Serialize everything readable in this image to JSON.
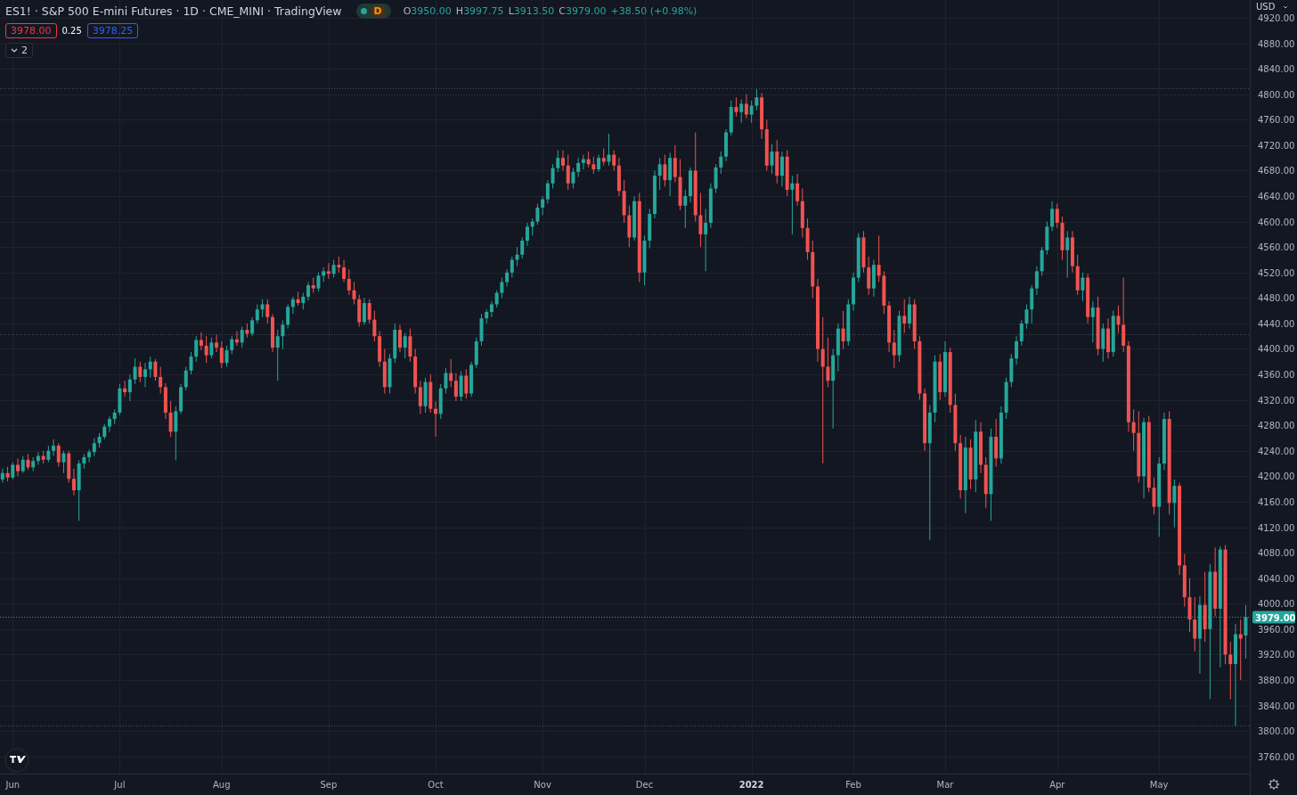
{
  "legend": {
    "title": "ES1! · S&P 500 E-mini Futures · 1D · CME_MINI · TradingView",
    "status_badge": {
      "label": "D"
    },
    "ohlc": [
      {
        "label": "O",
        "value": "3950.00"
      },
      {
        "label": "H",
        "value": "3997.75"
      },
      {
        "label": "L",
        "value": "3913.50"
      },
      {
        "label": "C",
        "value": "3979.00"
      }
    ],
    "change": "+38.50 (+0.98%)"
  },
  "quote": {
    "bid": "3978.00",
    "spread": "0.25",
    "ask": "3978.25"
  },
  "indicators_toggle": {
    "count": "2",
    "expanded": false
  },
  "price_axis": {
    "currency": "USD",
    "last_price": "3979.00"
  },
  "time_axis": {
    "labels": [
      {
        "kind": "month"
      },
      {
        "kind": "month"
      },
      {
        "kind": "month"
      },
      {
        "kind": "month"
      },
      {
        "kind": "month"
      },
      {
        "kind": "month"
      },
      {
        "kind": "month"
      },
      {
        "kind": "year"
      },
      {
        "kind": "month"
      },
      {
        "kind": "month"
      },
      {
        "kind": "month"
      },
      {
        "kind": "month"
      }
    ]
  },
  "chart_data": {
    "type": "candlestick",
    "grid": true,
    "ylim": [
      3733,
      4948
    ],
    "ref_lines": [
      {
        "axis": "y",
        "value": 4810,
        "color": "#4a4e59"
      },
      {
        "axis": "y",
        "value": 4423,
        "color": "#4a4e59"
      },
      {
        "axis": "y",
        "value": 3808,
        "color": "#4a4e59"
      },
      {
        "axis": "y",
        "value": 3979,
        "color": "#26a69a"
      }
    ],
    "categories": [
      null,
      null,
      "Jun",
      null,
      null,
      null,
      null,
      null,
      null,
      null,
      null,
      null,
      null,
      null,
      null,
      null,
      null,
      null,
      null,
      null,
      null,
      null,
      null,
      "Jul",
      null,
      null,
      null,
      null,
      null,
      null,
      null,
      null,
      null,
      null,
      null,
      null,
      null,
      null,
      null,
      null,
      null,
      null,
      null,
      "Aug",
      null,
      null,
      null,
      null,
      null,
      null,
      null,
      null,
      null,
      null,
      null,
      null,
      null,
      null,
      null,
      null,
      null,
      null,
      null,
      null,
      "Sep",
      null,
      null,
      null,
      null,
      null,
      null,
      null,
      null,
      null,
      null,
      null,
      null,
      null,
      null,
      null,
      null,
      null,
      null,
      null,
      null,
      "Oct",
      null,
      null,
      null,
      null,
      null,
      null,
      null,
      null,
      null,
      null,
      null,
      null,
      null,
      null,
      null,
      null,
      null,
      null,
      null,
      null,
      "Nov",
      null,
      null,
      null,
      null,
      null,
      null,
      null,
      null,
      null,
      null,
      null,
      null,
      null,
      null,
      null,
      null,
      null,
      null,
      null,
      "Dec",
      null,
      null,
      null,
      null,
      null,
      null,
      null,
      null,
      null,
      null,
      null,
      null,
      null,
      null,
      null,
      null,
      null,
      null,
      null,
      null,
      "2022",
      null,
      null,
      null,
      null,
      null,
      null,
      null,
      null,
      null,
      null,
      null,
      null,
      null,
      null,
      null,
      null,
      null,
      null,
      null,
      "Feb",
      null,
      null,
      null,
      null,
      null,
      null,
      null,
      null,
      null,
      null,
      null,
      null,
      null,
      null,
      null,
      null,
      null,
      "Mar",
      null,
      null,
      null,
      null,
      null,
      null,
      null,
      null,
      null,
      null,
      null,
      null,
      null,
      null,
      null,
      null,
      null,
      null,
      null,
      null,
      null,
      "Apr",
      null,
      null,
      null,
      null,
      null,
      null,
      null,
      null,
      null,
      null,
      null,
      null,
      null,
      null,
      null,
      null,
      null,
      null,
      null,
      "May",
      null,
      null,
      null,
      null,
      null,
      null,
      null,
      null,
      null,
      null,
      null,
      null,
      null,
      null,
      null,
      null,
      null
    ],
    "yticks": [
      {
        "value": 4920,
        "label": "4920.00"
      },
      {
        "value": 4880,
        "label": "4880.00"
      },
      {
        "value": 4840,
        "label": "4840.00"
      },
      {
        "value": 4800,
        "label": "4800.00"
      },
      {
        "value": 4760,
        "label": "4760.00"
      },
      {
        "value": 4720,
        "label": "4720.00"
      },
      {
        "value": 4680,
        "label": "4680.00"
      },
      {
        "value": 4640,
        "label": "4640.00"
      },
      {
        "value": 4600,
        "label": "4600.00"
      },
      {
        "value": 4560,
        "label": "4560.00"
      },
      {
        "value": 4520,
        "label": "4520.00"
      },
      {
        "value": 4480,
        "label": "4480.00"
      },
      {
        "value": 4440,
        "label": "4440.00"
      },
      {
        "value": 4400,
        "label": "4400.00"
      },
      {
        "value": 4360,
        "label": "4360.00"
      },
      {
        "value": 4320,
        "label": "4320.00"
      },
      {
        "value": 4280,
        "label": "4280.00"
      },
      {
        "value": 4240,
        "label": "4240.00"
      },
      {
        "value": 4200,
        "label": "4200.00"
      },
      {
        "value": 4160,
        "label": "4160.00"
      },
      {
        "value": 4120,
        "label": "4120.00"
      },
      {
        "value": 4080,
        "label": "4080.00"
      },
      {
        "value": 4040,
        "label": "4040.00"
      },
      {
        "value": 4000,
        "label": "4000.00"
      },
      {
        "value": 3960,
        "label": "3960.00"
      },
      {
        "value": 3920,
        "label": "3920.00"
      },
      {
        "value": 3880,
        "label": "3880.00"
      },
      {
        "value": 3840,
        "label": "3840.00"
      },
      {
        "value": 3800,
        "label": "3800.00"
      },
      {
        "value": 3760,
        "label": "3760.00"
      }
    ],
    "ohlc": [
      [
        4195,
        4212,
        4190,
        4205
      ],
      [
        4205,
        4215,
        4192,
        4198
      ],
      [
        4198,
        4222,
        4195,
        4218
      ],
      [
        4218,
        4228,
        4200,
        4208
      ],
      [
        4208,
        4232,
        4205,
        4226
      ],
      [
        4226,
        4235,
        4210,
        4214
      ],
      [
        4214,
        4230,
        4208,
        4224
      ],
      [
        4224,
        4238,
        4218,
        4232
      ],
      [
        4232,
        4240,
        4220,
        4226
      ],
      [
        4226,
        4248,
        4222,
        4240
      ],
      [
        4240,
        4258,
        4232,
        4248
      ],
      [
        4248,
        4252,
        4215,
        4222
      ],
      [
        4222,
        4240,
        4205,
        4236
      ],
      [
        4236,
        4240,
        4190,
        4196
      ],
      [
        4196,
        4212,
        4170,
        4178
      ],
      [
        4178,
        4225,
        4130,
        4220
      ],
      [
        4220,
        4235,
        4212,
        4230
      ],
      [
        4230,
        4242,
        4222,
        4238
      ],
      [
        4238,
        4260,
        4232,
        4252
      ],
      [
        4252,
        4268,
        4245,
        4262
      ],
      [
        4262,
        4282,
        4258,
        4278
      ],
      [
        4278,
        4294,
        4270,
        4290
      ],
      [
        4290,
        4305,
        4282,
        4300
      ],
      [
        4300,
        4345,
        4296,
        4338
      ],
      [
        4338,
        4350,
        4325,
        4332
      ],
      [
        4332,
        4360,
        4318,
        4352
      ],
      [
        4352,
        4385,
        4345,
        4372
      ],
      [
        4372,
        4380,
        4348,
        4356
      ],
      [
        4356,
        4378,
        4340,
        4368
      ],
      [
        4368,
        4388,
        4355,
        4380
      ],
      [
        4380,
        4384,
        4350,
        4356
      ],
      [
        4356,
        4372,
        4330,
        4340
      ],
      [
        4340,
        4346,
        4290,
        4300
      ],
      [
        4300,
        4318,
        4262,
        4270
      ],
      [
        4270,
        4310,
        4225,
        4302
      ],
      [
        4302,
        4345,
        4298,
        4340
      ],
      [
        4340,
        4372,
        4335,
        4366
      ],
      [
        4366,
        4395,
        4360,
        4388
      ],
      [
        4388,
        4420,
        4380,
        4414
      ],
      [
        4414,
        4426,
        4398,
        4405
      ],
      [
        4405,
        4420,
        4378,
        4390
      ],
      [
        4390,
        4418,
        4385,
        4410
      ],
      [
        4410,
        4422,
        4395,
        4402
      ],
      [
        4402,
        4412,
        4370,
        4378
      ],
      [
        4378,
        4405,
        4372,
        4398
      ],
      [
        4398,
        4420,
        4392,
        4415
      ],
      [
        4415,
        4428,
        4405,
        4410
      ],
      [
        4410,
        4435,
        4402,
        4430
      ],
      [
        4430,
        4440,
        4418,
        4424
      ],
      [
        4424,
        4450,
        4420,
        4445
      ],
      [
        4445,
        4470,
        4440,
        4462
      ],
      [
        4462,
        4478,
        4450,
        4470
      ],
      [
        4470,
        4478,
        4440,
        4450
      ],
      [
        4450,
        4455,
        4395,
        4402
      ],
      [
        4402,
        4430,
        4350,
        4420
      ],
      [
        4420,
        4445,
        4400,
        4438
      ],
      [
        4438,
        4470,
        4432,
        4466
      ],
      [
        4466,
        4482,
        4455,
        4478
      ],
      [
        4478,
        4490,
        4468,
        4472
      ],
      [
        4472,
        4488,
        4462,
        4482
      ],
      [
        4482,
        4505,
        4476,
        4500
      ],
      [
        4500,
        4512,
        4488,
        4495
      ],
      [
        4495,
        4520,
        4490,
        4515
      ],
      [
        4515,
        4528,
        4505,
        4522
      ],
      [
        4522,
        4535,
        4510,
        4518
      ],
      [
        4518,
        4540,
        4512,
        4532
      ],
      [
        4532,
        4545,
        4520,
        4528
      ],
      [
        4528,
        4540,
        4505,
        4510
      ],
      [
        4510,
        4525,
        4485,
        4492
      ],
      [
        4492,
        4505,
        4470,
        4478
      ],
      [
        4478,
        4485,
        4435,
        4442
      ],
      [
        4442,
        4480,
        4438,
        4472
      ],
      [
        4472,
        4478,
        4440,
        4446
      ],
      [
        4446,
        4460,
        4412,
        4420
      ],
      [
        4420,
        4428,
        4372,
        4380
      ],
      [
        4380,
        4400,
        4330,
        4340
      ],
      [
        4340,
        4392,
        4330,
        4385
      ],
      [
        4385,
        4440,
        4378,
        4430
      ],
      [
        4430,
        4438,
        4395,
        4402
      ],
      [
        4402,
        4425,
        4385,
        4420
      ],
      [
        4420,
        4432,
        4380,
        4388
      ],
      [
        4388,
        4400,
        4330,
        4340
      ],
      [
        4340,
        4350,
        4298,
        4310
      ],
      [
        4310,
        4355,
        4300,
        4348
      ],
      [
        4348,
        4360,
        4300,
        4306
      ],
      [
        4306,
        4318,
        4262,
        4298
      ],
      [
        4298,
        4345,
        4290,
        4338
      ],
      [
        4338,
        4370,
        4330,
        4362
      ],
      [
        4362,
        4384,
        4340,
        4350
      ],
      [
        4350,
        4362,
        4318,
        4325
      ],
      [
        4325,
        4365,
        4318,
        4358
      ],
      [
        4358,
        4368,
        4322,
        4330
      ],
      [
        4330,
        4380,
        4325,
        4375
      ],
      [
        4375,
        4418,
        4370,
        4412
      ],
      [
        4412,
        4455,
        4405,
        4448
      ],
      [
        4448,
        4462,
        4440,
        4458
      ],
      [
        4458,
        4475,
        4450,
        4470
      ],
      [
        4470,
        4492,
        4465,
        4488
      ],
      [
        4488,
        4512,
        4480,
        4505
      ],
      [
        4505,
        4525,
        4498,
        4520
      ],
      [
        4520,
        4545,
        4512,
        4540
      ],
      [
        4540,
        4560,
        4530,
        4548
      ],
      [
        4548,
        4575,
        4542,
        4570
      ],
      [
        4570,
        4598,
        4562,
        4592
      ],
      [
        4592,
        4605,
        4578,
        4600
      ],
      [
        4600,
        4628,
        4595,
        4622
      ],
      [
        4622,
        4640,
        4610,
        4635
      ],
      [
        4635,
        4665,
        4628,
        4660
      ],
      [
        4660,
        4690,
        4652,
        4684
      ],
      [
        4684,
        4712,
        4678,
        4700
      ],
      [
        4700,
        4712,
        4680,
        4688
      ],
      [
        4688,
        4705,
        4650,
        4660
      ],
      [
        4660,
        4684,
        4652,
        4678
      ],
      [
        4678,
        4700,
        4670,
        4692
      ],
      [
        4692,
        4705,
        4682,
        4698
      ],
      [
        4698,
        4710,
        4685,
        4690
      ],
      [
        4690,
        4702,
        4675,
        4682
      ],
      [
        4682,
        4705,
        4678,
        4700
      ],
      [
        4700,
        4715,
        4688,
        4694
      ],
      [
        4694,
        4738,
        4688,
        4705
      ],
      [
        4705,
        4712,
        4680,
        4688
      ],
      [
        4688,
        4700,
        4640,
        4648
      ],
      [
        4648,
        4665,
        4598,
        4610
      ],
      [
        4610,
        4625,
        4560,
        4575
      ],
      [
        4575,
        4640,
        4570,
        4632
      ],
      [
        4632,
        4645,
        4505,
        4520
      ],
      [
        4520,
        4578,
        4500,
        4570
      ],
      [
        4570,
        4620,
        4558,
        4612
      ],
      [
        4612,
        4680,
        4605,
        4672
      ],
      [
        4672,
        4700,
        4650,
        4690
      ],
      [
        4690,
        4705,
        4655,
        4665
      ],
      [
        4665,
        4708,
        4640,
        4700
      ],
      [
        4700,
        4720,
        4662,
        4670
      ],
      [
        4670,
        4698,
        4618,
        4625
      ],
      [
        4625,
        4650,
        4590,
        4640
      ],
      [
        4640,
        4685,
        4630,
        4680
      ],
      [
        4680,
        4740,
        4600,
        4610
      ],
      [
        4610,
        4645,
        4560,
        4580
      ],
      [
        4580,
        4620,
        4522,
        4598
      ],
      [
        4598,
        4660,
        4590,
        4652
      ],
      [
        4652,
        4690,
        4645,
        4685
      ],
      [
        4685,
        4710,
        4675,
        4702
      ],
      [
        4702,
        4745,
        4695,
        4740
      ],
      [
        4740,
        4790,
        4735,
        4780
      ],
      [
        4780,
        4795,
        4765,
        4772
      ],
      [
        4772,
        4792,
        4755,
        4785
      ],
      [
        4785,
        4800,
        4762,
        4768
      ],
      [
        4768,
        4790,
        4755,
        4782
      ],
      [
        4782,
        4808,
        4775,
        4795
      ],
      [
        4795,
        4802,
        4730,
        4745
      ],
      [
        4745,
        4760,
        4680,
        4688
      ],
      [
        4688,
        4722,
        4675,
        4710
      ],
      [
        4710,
        4728,
        4660,
        4672
      ],
      [
        4672,
        4710,
        4655,
        4702
      ],
      [
        4702,
        4712,
        4640,
        4650
      ],
      [
        4650,
        4672,
        4580,
        4660
      ],
      [
        4660,
        4675,
        4625,
        4632
      ],
      [
        4632,
        4652,
        4575,
        4590
      ],
      [
        4590,
        4605,
        4540,
        4552
      ],
      [
        4552,
        4570,
        4480,
        4498
      ],
      [
        4498,
        4510,
        4380,
        4400
      ],
      [
        4400,
        4450,
        4220,
        4372
      ],
      [
        4372,
        4418,
        4340,
        4350
      ],
      [
        4350,
        4400,
        4275,
        4390
      ],
      [
        4390,
        4440,
        4365,
        4432
      ],
      [
        4432,
        4460,
        4400,
        4412
      ],
      [
        4412,
        4478,
        4405,
        4470
      ],
      [
        4470,
        4520,
        4460,
        4512
      ],
      [
        4512,
        4582,
        4505,
        4575
      ],
      [
        4575,
        4585,
        4520,
        4528
      ],
      [
        4528,
        4545,
        4485,
        4495
      ],
      [
        4495,
        4540,
        4482,
        4532
      ],
      [
        4532,
        4578,
        4505,
        4515
      ],
      [
        4515,
        4522,
        4455,
        4468
      ],
      [
        4468,
        4475,
        4395,
        4410
      ],
      [
        4410,
        4430,
        4370,
        4390
      ],
      [
        4390,
        4460,
        4380,
        4452
      ],
      [
        4452,
        4478,
        4425,
        4440
      ],
      [
        4440,
        4482,
        4432,
        4470
      ],
      [
        4470,
        4478,
        4400,
        4412
      ],
      [
        4412,
        4420,
        4320,
        4330
      ],
      [
        4330,
        4338,
        4240,
        4252
      ],
      [
        4252,
        4312,
        4100,
        4300
      ],
      [
        4300,
        4390,
        4285,
        4380
      ],
      [
        4380,
        4392,
        4320,
        4332
      ],
      [
        4332,
        4412,
        4325,
        4395
      ],
      [
        4395,
        4402,
        4300,
        4312
      ],
      [
        4312,
        4330,
        4240,
        4252
      ],
      [
        4252,
        4265,
        4165,
        4178
      ],
      [
        4178,
        4262,
        4142,
        4245
      ],
      [
        4245,
        4258,
        4180,
        4195
      ],
      [
        4195,
        4288,
        4175,
        4270
      ],
      [
        4270,
        4285,
        4205,
        4218
      ],
      [
        4218,
        4230,
        4150,
        4172
      ],
      [
        4172,
        4275,
        4130,
        4262
      ],
      [
        4262,
        4290,
        4215,
        4228
      ],
      [
        4228,
        4310,
        4220,
        4300
      ],
      [
        4300,
        4355,
        4290,
        4348
      ],
      [
        4348,
        4392,
        4340,
        4385
      ],
      [
        4385,
        4420,
        4375,
        4412
      ],
      [
        4412,
        4445,
        4405,
        4440
      ],
      [
        4440,
        4470,
        4432,
        4462
      ],
      [
        4462,
        4500,
        4440,
        4495
      ],
      [
        4495,
        4530,
        4485,
        4522
      ],
      [
        4522,
        4560,
        4515,
        4555
      ],
      [
        4555,
        4600,
        4548,
        4592
      ],
      [
        4592,
        4632,
        4585,
        4620
      ],
      [
        4620,
        4628,
        4590,
        4598
      ],
      [
        4598,
        4608,
        4540,
        4555
      ],
      [
        4555,
        4585,
        4512,
        4575
      ],
      [
        4575,
        4585,
        4520,
        4530
      ],
      [
        4530,
        4548,
        4485,
        4492
      ],
      [
        4492,
        4520,
        4475,
        4512
      ],
      [
        4512,
        4518,
        4440,
        4450
      ],
      [
        4450,
        4475,
        4410,
        4465
      ],
      [
        4465,
        4482,
        4390,
        4400
      ],
      [
        4400,
        4440,
        4380,
        4432
      ],
      [
        4432,
        4448,
        4385,
        4395
      ],
      [
        4395,
        4460,
        4388,
        4452
      ],
      [
        4452,
        4468,
        4425,
        4438
      ],
      [
        4438,
        4512,
        4395,
        4405
      ],
      [
        4405,
        4412,
        4270,
        4285
      ],
      [
        4285,
        4305,
        4240,
        4268
      ],
      [
        4268,
        4302,
        4190,
        4200
      ],
      [
        4200,
        4292,
        4165,
        4285
      ],
      [
        4285,
        4295,
        4175,
        4182
      ],
      [
        4182,
        4198,
        4140,
        4152
      ],
      [
        4152,
        4230,
        4105,
        4220
      ],
      [
        4220,
        4300,
        4210,
        4290
      ],
      [
        4290,
        4302,
        4140,
        4158
      ],
      [
        4158,
        4195,
        4120,
        4185
      ],
      [
        4185,
        4190,
        4045,
        4060
      ],
      [
        4060,
        4078,
        3995,
        4010
      ],
      [
        4010,
        4040,
        3955,
        3975
      ],
      [
        3975,
        4010,
        3925,
        3945
      ],
      [
        3945,
        4012,
        3890,
        3998
      ],
      [
        3998,
        4050,
        3940,
        3960
      ],
      [
        3960,
        4062,
        3850,
        4050
      ],
      [
        4050,
        4088,
        3980,
        3992
      ],
      [
        3992,
        4090,
        3900,
        4085
      ],
      [
        4085,
        4092,
        3905,
        3920
      ],
      [
        3920,
        3940,
        3850,
        3905
      ],
      [
        3905,
        3968,
        3808,
        3952
      ],
      [
        3952,
        3975,
        3880,
        3945
      ],
      [
        3950,
        3997.75,
        3913.5,
        3979
      ]
    ]
  }
}
